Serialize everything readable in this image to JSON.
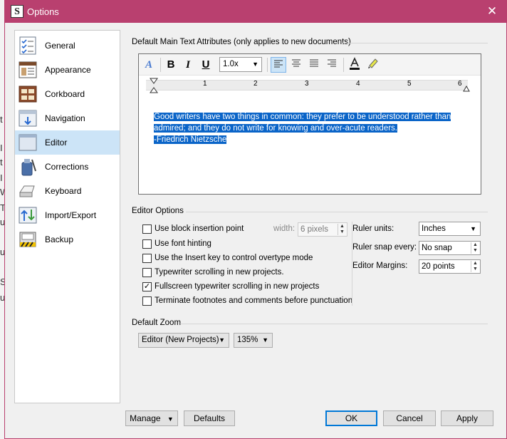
{
  "window": {
    "title": "Options",
    "app_icon": "S"
  },
  "sidebar": {
    "items": [
      {
        "label": "General",
        "icon": "checklist-icon"
      },
      {
        "label": "Appearance",
        "icon": "appearance-icon"
      },
      {
        "label": "Corkboard",
        "icon": "corkboard-icon"
      },
      {
        "label": "Navigation",
        "icon": "navigation-icon"
      },
      {
        "label": "Editor",
        "icon": "editor-icon",
        "selected": true
      },
      {
        "label": "Corrections",
        "icon": "corrections-icon"
      },
      {
        "label": "Keyboard",
        "icon": "keyboard-icon"
      },
      {
        "label": "Import/Export",
        "icon": "import-export-icon"
      },
      {
        "label": "Backup",
        "icon": "backup-icon"
      }
    ]
  },
  "text_attributes": {
    "heading": "Default Main Text Attributes (only applies to new documents)",
    "toolbar": {
      "font_button": "A",
      "bold": "B",
      "italic": "I",
      "underline": "U",
      "line_spacing": "1.0x"
    },
    "ruler_numbers": [
      "1",
      "2",
      "3",
      "4",
      "5",
      "6"
    ],
    "sample_lines": [
      "Good writers have two things in common: they prefer to be understood rather than",
      "admired; and they do not write for knowing and over-acute readers.",
      "-Friedrich Nietzsche"
    ]
  },
  "editor_options": {
    "heading": "Editor Options",
    "checkboxes": [
      {
        "label": "Use block insertion point",
        "checked": false
      },
      {
        "label": "Use font hinting",
        "checked": false
      },
      {
        "label": "Use the Insert key to control overtype mode",
        "checked": false
      },
      {
        "label": "Typewriter scrolling in new projects.",
        "checked": false
      },
      {
        "label": "Fullscreen typewriter scrolling in new projects",
        "checked": true
      },
      {
        "label": "Terminate footnotes and comments before punctuation",
        "checked": false
      }
    ],
    "width_label": "width:",
    "width_value": "6 pixels",
    "ruler_units_label": "Ruler units:",
    "ruler_units_value": "Inches",
    "ruler_snap_label": "Ruler snap every:",
    "ruler_snap_value": "No snap",
    "editor_margins_label": "Editor Margins:",
    "editor_margins_value": "20 points"
  },
  "default_zoom": {
    "heading": "Default Zoom",
    "mode_value": "Editor (New Projects)",
    "zoom_value": "135%"
  },
  "buttons": {
    "manage": "Manage",
    "defaults": "Defaults",
    "ok": "OK",
    "cancel": "Cancel",
    "apply": "Apply"
  },
  "colors": {
    "titlebar": "#b9406f",
    "selection": "#0a64c8",
    "sidebar_selected": "#cce4f7",
    "default_button_border": "#0078d7"
  },
  "background_window": {
    "fragments": [
      "t",
      "I",
      "t",
      "I",
      "W",
      "T",
      "u",
      "u",
      "S",
      "u"
    ]
  }
}
